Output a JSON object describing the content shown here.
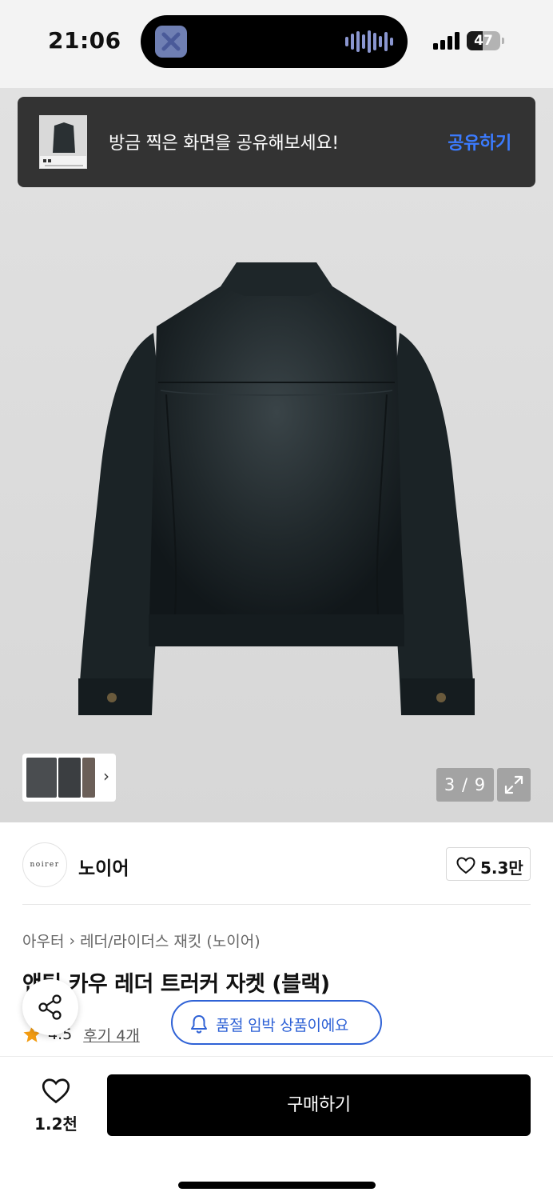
{
  "status_bar": {
    "time": "21:06",
    "battery": "47",
    "battery_level": 0.47,
    "signal_icon": "cellular-signal-icon",
    "island_icons": [
      "app-icon",
      "audio-waveform-icon"
    ]
  },
  "toast": {
    "message": "방금 찍은 화면을 공유해보세요!",
    "action_label": "공유하기",
    "action_color": "#3b7bff",
    "thumbnail_icon": "screenshot-thumbnail"
  },
  "gallery": {
    "counter": "3 / 9",
    "expand_icon": "expand-icon",
    "thumbnails_arrow": "›"
  },
  "brand": {
    "logo_text": "noirer",
    "name": "노이어",
    "like_count": "5.3만"
  },
  "product": {
    "breadcrumb": [
      "아우터",
      "레더/라이더스 재킷 (노이어)"
    ],
    "title": "앤틱 카우 레더 트러커 자켓 (블랙)",
    "rating": "4.5",
    "reviews": "후기 4개",
    "stock_notice": "품절 임박 상품이에요",
    "accent_color": "#2f62d6",
    "star_color": "#f39c12"
  },
  "bottom_bar": {
    "wish_count": "1.2천",
    "buy_label": "구매하기"
  }
}
